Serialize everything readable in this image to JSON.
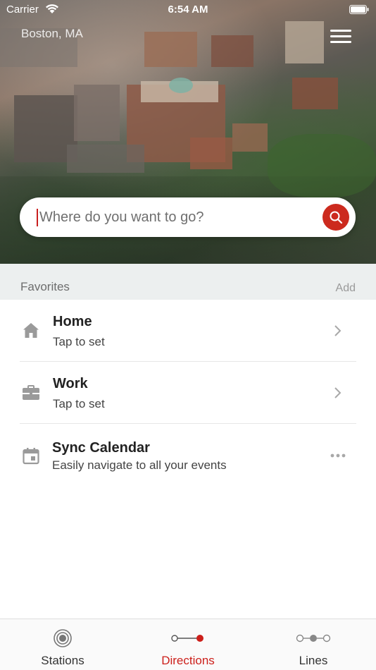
{
  "status_bar": {
    "carrier": "Carrier",
    "time": "6:54 AM"
  },
  "header": {
    "location": "Boston, MA"
  },
  "search": {
    "placeholder": "Where do you want to go?",
    "value": ""
  },
  "favorites": {
    "title": "Favorites",
    "add_label": "Add",
    "items": [
      {
        "icon": "home-icon",
        "title": "Home",
        "subtitle": "Tap to set",
        "action": "chevron-right-icon"
      },
      {
        "icon": "briefcase-icon",
        "title": "Work",
        "subtitle": "Tap to set",
        "action": "chevron-right-icon"
      },
      {
        "icon": "calendar-icon",
        "title": "Sync Calendar",
        "subtitle": "Easily navigate to all your events",
        "action": "more-icon"
      }
    ]
  },
  "tabs": [
    {
      "label": "Stations",
      "icon": "stations-icon",
      "active": false
    },
    {
      "label": "Directions",
      "icon": "directions-icon",
      "active": true
    },
    {
      "label": "Lines",
      "icon": "lines-icon",
      "active": false
    }
  ],
  "colors": {
    "accent": "#cc2a1e",
    "favorites_bg": "#ecefef",
    "tabbar_bg": "#fafafa"
  }
}
